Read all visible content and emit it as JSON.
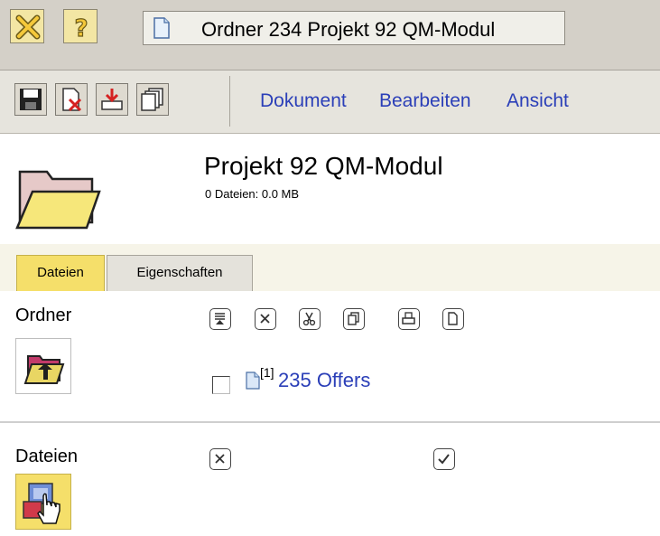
{
  "titlebar": {
    "document_title": "Ordner 234 Projekt 92 QM-Modul",
    "icons": [
      "close-icon",
      "help-icon",
      "document-icon"
    ]
  },
  "toolbar": {
    "icons": [
      "save-icon",
      "delete-document-icon",
      "download-icon",
      "copy-pages-icon"
    ],
    "menu": [
      "Dokument",
      "Bearbeiten",
      "Ansicht"
    ]
  },
  "header": {
    "title": "Projekt 92 QM-Modul",
    "subtitle": "0 Dateien: 0.0 MB",
    "icon": "folder-icon"
  },
  "tabs": [
    {
      "label": "Dateien",
      "active": true
    },
    {
      "label": "Eigenschaften",
      "active": false
    }
  ],
  "folders_section": {
    "label": "Ordner",
    "actions": [
      "move-to-top-icon",
      "delete-icon",
      "cut-icon",
      "copy-icon",
      "print-icon",
      "new-page-icon"
    ],
    "up_icon": "folder-up-icon",
    "items": [
      {
        "count": "[1]",
        "name": "235 Offers",
        "checked": false
      }
    ]
  },
  "files_section": {
    "label": "Dateien",
    "actions": [
      "delete-icon",
      "check-icon"
    ],
    "upload_icon": "upload-file-icon"
  },
  "colors": {
    "link": "#2b3fb8",
    "active_tab": "#f5df6a",
    "titlebar_bg": "#d4d0c8"
  }
}
